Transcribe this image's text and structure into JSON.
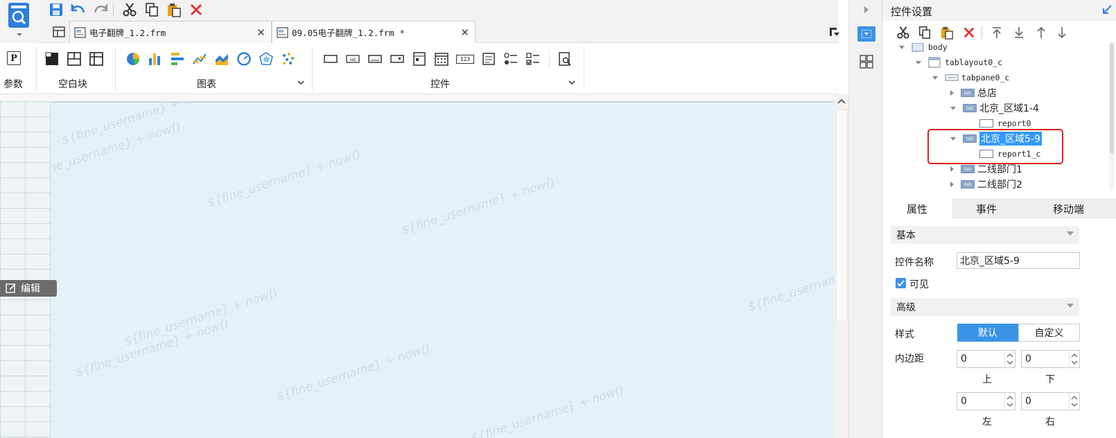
{
  "tabs": [
    {
      "label": "电子翻牌_1.2.frm"
    },
    {
      "label": "09.05电子翻牌_1.2.frm *"
    }
  ],
  "ribbon": {
    "groups": [
      {
        "label": "参数"
      },
      {
        "label": "空白块"
      },
      {
        "label": "图表"
      },
      {
        "label": "控件"
      }
    ],
    "param_glyph": "P",
    "num_glyph": "123"
  },
  "canvas": {
    "watermark": "${fine_username} + now()",
    "edit_label": "编辑"
  },
  "panel": {
    "title": "控件设置",
    "tree": [
      {
        "label": "body",
        "kind": "body"
      },
      {
        "label": "tablayout0_c",
        "kind": "layout"
      },
      {
        "label": "tabpane0_c",
        "kind": "pane"
      },
      {
        "label": "总店",
        "kind": "tab"
      },
      {
        "label": "北京_区域1-4",
        "kind": "tab"
      },
      {
        "label": "report0",
        "kind": "report"
      },
      {
        "label": "北京_区域5-9",
        "kind": "tab",
        "selected": true
      },
      {
        "label": "report1_c",
        "kind": "report"
      },
      {
        "label": "二线部门1",
        "kind": "tab"
      },
      {
        "label": "二线部门2",
        "kind": "tab"
      }
    ],
    "prop_tabs": [
      "属性",
      "事件",
      "移动端"
    ],
    "basic": {
      "section": "基本",
      "name_label": "控件名称",
      "name_value": "北京_区域5-9",
      "visible_label": "可见"
    },
    "advanced": {
      "section": "高级",
      "style_label": "样式",
      "style_options": [
        "默认",
        "自定义"
      ],
      "padding_label": "内边距",
      "padding": {
        "top": "0",
        "bottom": "0",
        "left": "0",
        "right": "0"
      },
      "pad_top_label": "上",
      "pad_bottom_label": "下",
      "pad_left_label": "左",
      "pad_right_label": "右"
    }
  },
  "colors": {
    "accent": "#3b93e6",
    "selection": "#3399ff",
    "highlight_box": "#e02020",
    "delete_red": "#e03030"
  }
}
